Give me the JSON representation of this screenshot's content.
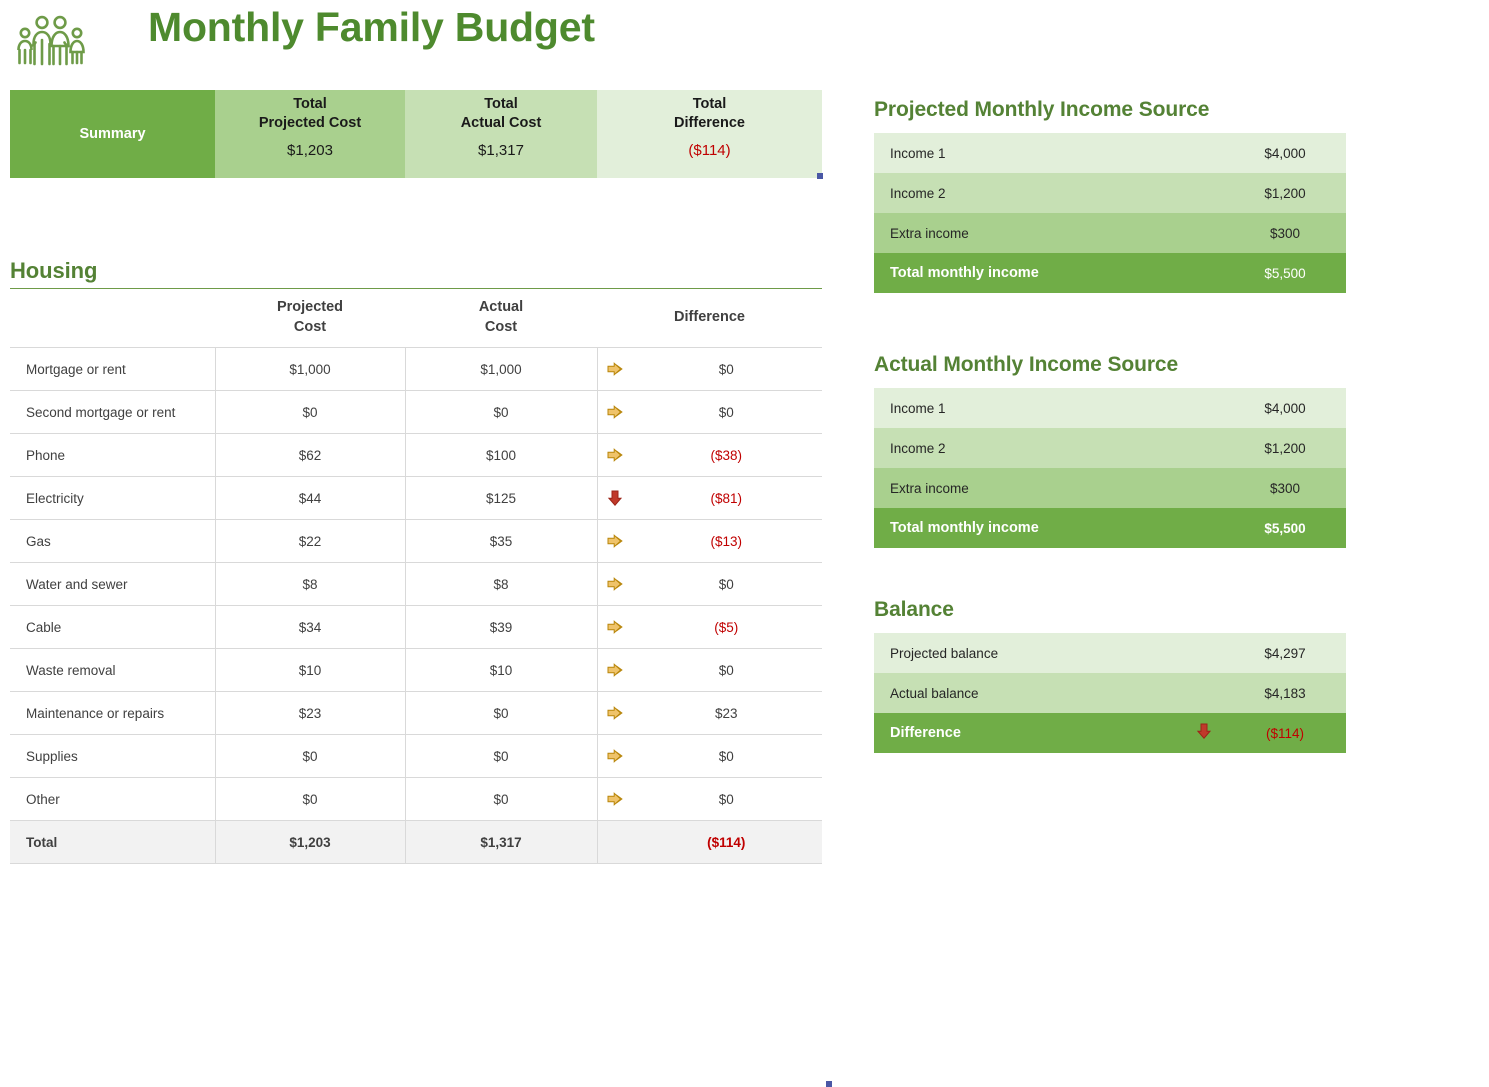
{
  "page": {
    "title": "Monthly Family Budget",
    "icon": "family-icon",
    "colors": {
      "brand_green": "#548235",
      "title_green": "#4E8A2E",
      "dark_green": "#70AD47",
      "mid_green": "#A9D08E",
      "light_green": "#C6E0B4",
      "pale_green": "#E2EFDA",
      "negative_red": "#C00000",
      "grid_gray": "#D9D9D9",
      "total_row_gray": "#F2F2F2",
      "arrow_yellow": "#E8B44A",
      "arrow_red": "#C0392B",
      "handle_blue": "#4A57A5"
    }
  },
  "summary": {
    "cells": [
      {
        "label": "Summary",
        "value": ""
      },
      {
        "label_line1": "Total",
        "label_line2": "Projected Cost",
        "value": "$1,203",
        "negative": false
      },
      {
        "label_line1": "Total",
        "label_line2": "Actual Cost",
        "value": "$1,317",
        "negative": false
      },
      {
        "label_line1": "Total",
        "label_line2": "Difference",
        "value": "($114)",
        "negative": true
      }
    ]
  },
  "housing": {
    "section_title": "Housing",
    "headers": {
      "item": "",
      "projected_line1": "Projected",
      "projected_line2": "Cost",
      "actual_line1": "Actual",
      "actual_line2": "Cost",
      "difference": "Difference"
    },
    "rows": [
      {
        "item": "Mortgage or rent",
        "projected": "$1,000",
        "actual": "$1,000",
        "difference": "$0",
        "negative": false,
        "icon": "arrow-right-yellow-icon"
      },
      {
        "item": "Second mortgage or rent",
        "projected": "$0",
        "actual": "$0",
        "difference": "$0",
        "negative": false,
        "icon": "arrow-right-yellow-icon"
      },
      {
        "item": "Phone",
        "projected": "$62",
        "actual": "$100",
        "difference": "($38)",
        "negative": true,
        "icon": "arrow-right-yellow-icon"
      },
      {
        "item": "Electricity",
        "projected": "$44",
        "actual": "$125",
        "difference": "($81)",
        "negative": true,
        "icon": "arrow-down-red-icon"
      },
      {
        "item": "Gas",
        "projected": "$22",
        "actual": "$35",
        "difference": "($13)",
        "negative": true,
        "icon": "arrow-right-yellow-icon"
      },
      {
        "item": "Water and sewer",
        "projected": "$8",
        "actual": "$8",
        "difference": "$0",
        "negative": false,
        "icon": "arrow-right-yellow-icon"
      },
      {
        "item": "Cable",
        "projected": "$34",
        "actual": "$39",
        "difference": "($5)",
        "negative": true,
        "icon": "arrow-right-yellow-icon"
      },
      {
        "item": "Waste removal",
        "projected": "$10",
        "actual": "$10",
        "difference": "$0",
        "negative": false,
        "icon": "arrow-right-yellow-icon"
      },
      {
        "item": "Maintenance or repairs",
        "projected": "$23",
        "actual": "$0",
        "difference": "$23",
        "negative": false,
        "icon": "arrow-right-yellow-icon"
      },
      {
        "item": "Supplies",
        "projected": "$0",
        "actual": "$0",
        "difference": "$0",
        "negative": false,
        "icon": "arrow-right-yellow-icon"
      },
      {
        "item": "Other",
        "projected": "$0",
        "actual": "$0",
        "difference": "$0",
        "negative": false,
        "icon": "arrow-right-yellow-icon"
      }
    ],
    "total": {
      "item": "Total",
      "projected": "$1,203",
      "actual": "$1,317",
      "difference": "($114)",
      "negative": true,
      "icon": ""
    }
  },
  "projected_income": {
    "title": "Projected Monthly Income Source",
    "rows": [
      {
        "label": "Income 1",
        "value": "$4,000"
      },
      {
        "label": "Income 2",
        "value": "$1,200"
      },
      {
        "label": "Extra income",
        "value": "$300"
      },
      {
        "label": "Total monthly income",
        "value": "$5,500"
      }
    ]
  },
  "actual_income": {
    "title": "Actual Monthly Income Source",
    "rows": [
      {
        "label": "Income 1",
        "value": "$4,000"
      },
      {
        "label": "Income 2",
        "value": "$1,200"
      },
      {
        "label": "Extra income",
        "value": "$300"
      },
      {
        "label": "Total monthly income",
        "value": "$5,500"
      }
    ]
  },
  "balance": {
    "title": "Balance",
    "rows": [
      {
        "label": "Projected balance",
        "value": "$4,297",
        "negative": false,
        "icon": ""
      },
      {
        "label": "Actual balance",
        "value": "$4,183",
        "negative": false,
        "icon": ""
      },
      {
        "label": "Difference",
        "value": "($114)",
        "negative": true,
        "icon": "arrow-down-red-icon"
      }
    ]
  }
}
